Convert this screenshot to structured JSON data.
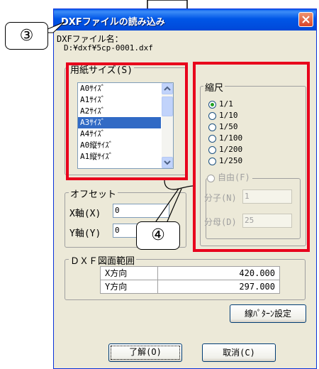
{
  "dialog": {
    "title": "DXFファイルの読み込み",
    "filename_label": "DXFファイル名：",
    "filename_value": "D:¥dxf¥5cp-0001.dxf"
  },
  "paper_size": {
    "group_label": "用紙サイズ(S)",
    "items": [
      "A0ｻｲｽﾞ",
      "A1ｻｲｽﾞ",
      "A2ｻｲｽﾞ",
      "A3ｻｲｽﾞ",
      "A4ｻｲｽﾞ",
      "A0縦ｻｲｽﾞ",
      "A1縦ｻｲｽﾞ"
    ],
    "selected": "A3ｻｲｽﾞ"
  },
  "scale": {
    "group_label": "縮尺",
    "options": [
      "1/1",
      "1/10",
      "1/50",
      "1/100",
      "1/200",
      "1/250"
    ],
    "selected": "1/1",
    "free_label": "自由(F)",
    "numerator_label": "分子(N)",
    "numerator_value": "1",
    "denominator_label": "分母(D)",
    "denominator_value": "25"
  },
  "offset": {
    "group_label": "オフセット",
    "x_label": "X軸(X)",
    "x_value": "0",
    "y_label": "Y軸(Y)",
    "y_value": "0"
  },
  "range": {
    "group_label": "ＤＸＦ図面範囲",
    "x_label": "X方向",
    "x_value": "420.000",
    "y_label": "Y方向",
    "y_value": "297.000"
  },
  "buttons": {
    "line_pattern": "線ﾊﾟﾀｰﾝ設定",
    "ok": "了解(O)",
    "cancel": "取消(C)"
  },
  "callouts": {
    "c3": "③",
    "c4": "④"
  },
  "colors": {
    "highlight_red": "#E8001C",
    "title_blue": "#0054E3",
    "selection_blue": "#316AC5"
  }
}
